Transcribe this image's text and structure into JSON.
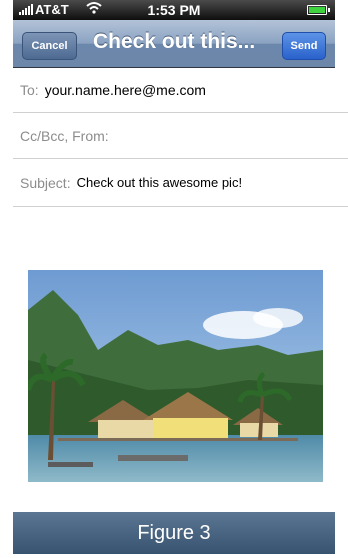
{
  "status_bar": {
    "carrier": "AT&T",
    "time": "1:53 PM",
    "icons": [
      "signal-icon",
      "wifi-icon",
      "battery-icon"
    ]
  },
  "nav_bar": {
    "cancel_label": "Cancel",
    "title": "Check out this...",
    "send_label": "Send"
  },
  "fields": {
    "to_label": "To:",
    "to_value": "your.name.here@me.com",
    "cc_label": "Cc/Bcc, From:",
    "subject_label": "Subject:",
    "subject_value": "Check out this awesome pic!"
  },
  "caption": "Figure 3",
  "colors": {
    "nav_blue": "#6d87aa",
    "send_blue": "#2a62cc",
    "caption_blue": "#375370"
  }
}
